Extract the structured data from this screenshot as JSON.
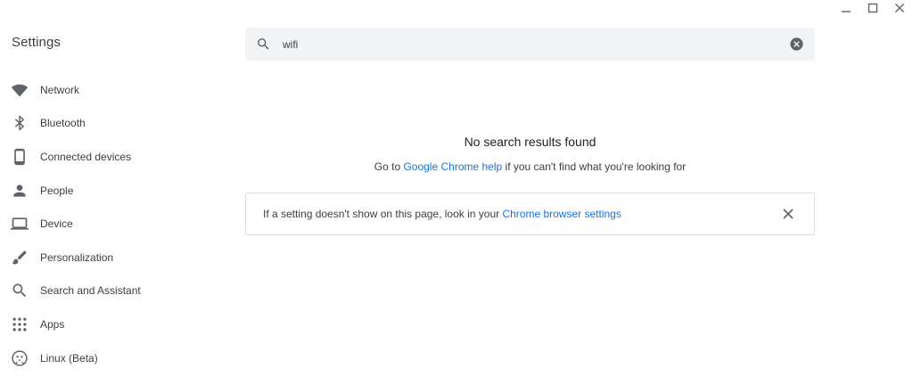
{
  "window": {
    "minimize_icon": "minimize-icon",
    "maximize_icon": "maximize-icon",
    "close_icon": "close-icon"
  },
  "app": {
    "title": "Settings"
  },
  "sidebar": {
    "items": [
      {
        "label": "Network",
        "icon": "wifi-icon"
      },
      {
        "label": "Bluetooth",
        "icon": "bluetooth-icon"
      },
      {
        "label": "Connected devices",
        "icon": "phone-icon"
      },
      {
        "label": "People",
        "icon": "person-icon"
      },
      {
        "label": "Device",
        "icon": "laptop-icon"
      },
      {
        "label": "Personalization",
        "icon": "brush-icon"
      },
      {
        "label": "Search and Assistant",
        "icon": "search-icon"
      },
      {
        "label": "Apps",
        "icon": "apps-grid-icon"
      },
      {
        "label": "Linux (Beta)",
        "icon": "penguin-icon"
      }
    ]
  },
  "search": {
    "value": "wifi",
    "icon": "search-icon",
    "clear_icon": "clear-icon"
  },
  "results": {
    "heading": "No search results found",
    "help_prefix": "Go to ",
    "help_link": "Google Chrome help",
    "help_suffix": " if you can't find what you're looking for"
  },
  "info_card": {
    "text": "If a setting doesn't show on this page, look in your ",
    "link": "Chrome browser settings",
    "close_icon": "close-icon"
  },
  "colors": {
    "accent": "#1a73e8",
    "icon": "#5f6368",
    "search_bg": "#f1f3f4",
    "border": "#dadce0"
  }
}
